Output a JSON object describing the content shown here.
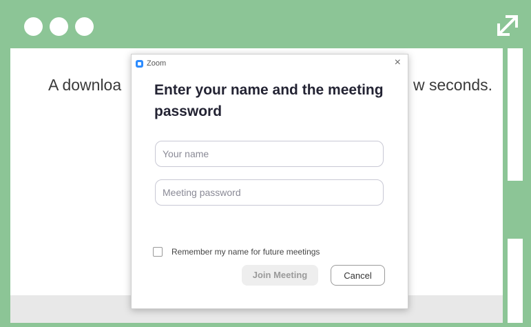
{
  "browser": {
    "window_dots": [
      "dot-1",
      "dot-2",
      "dot-3"
    ],
    "expand_icon": "expand-arrows-icon",
    "frame_color": "#8cc596"
  },
  "page": {
    "text_left": "A downloa",
    "text_right": "w seconds."
  },
  "dialog": {
    "app_name": "Zoom",
    "close_label": "×",
    "heading": "Enter your name and the meeting password",
    "name_placeholder": "Your name",
    "name_value": "",
    "password_placeholder": "Meeting password",
    "password_value": "",
    "remember_label": "Remember my name for future meetings",
    "remember_checked": false,
    "join_label": "Join Meeting",
    "cancel_label": "Cancel",
    "accent_color": "#2d8cff"
  }
}
